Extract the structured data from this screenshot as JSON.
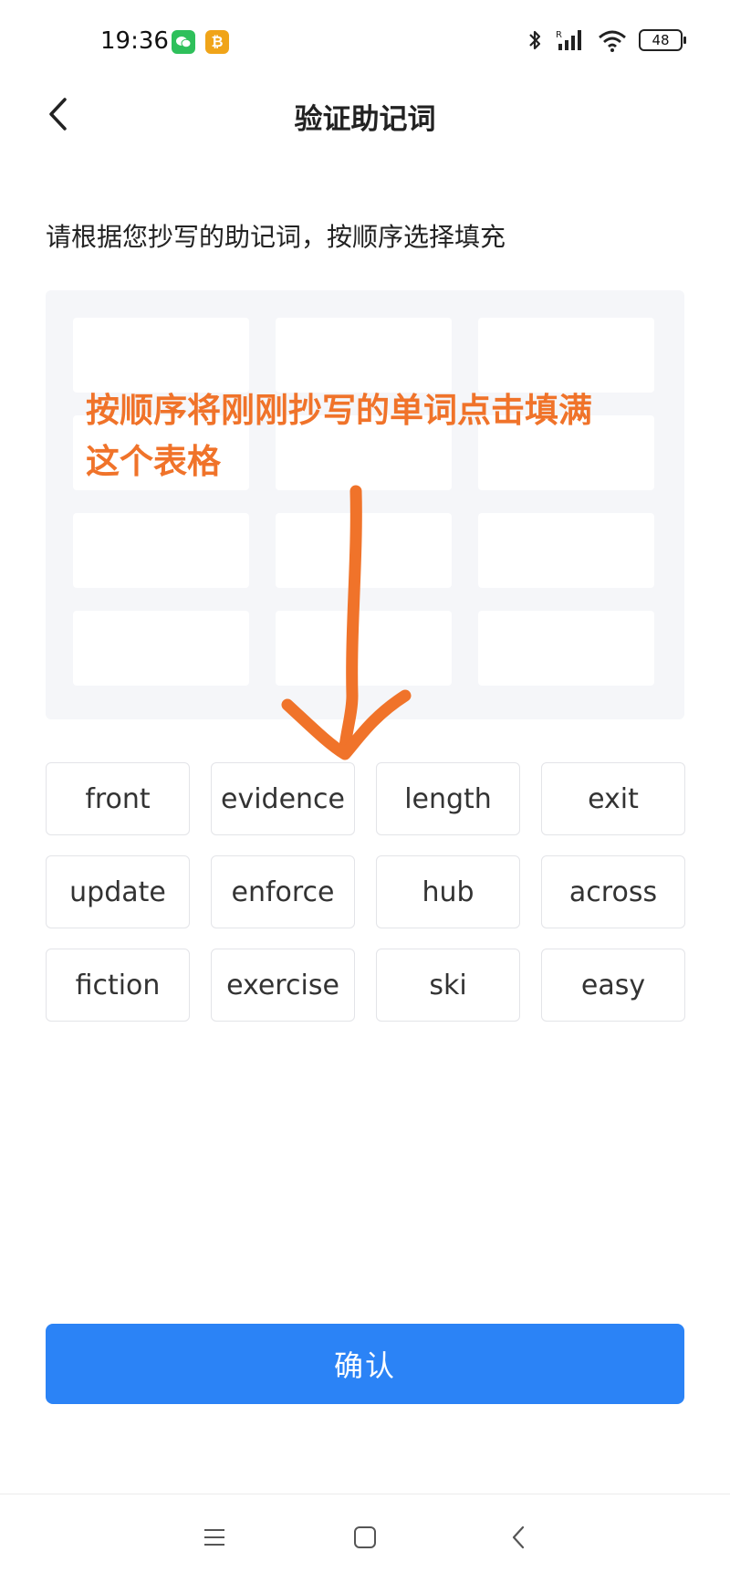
{
  "status_bar": {
    "time": "19:36",
    "battery": "48",
    "app_icons": [
      "wechat-icon",
      "bitcoin-icon"
    ],
    "system_icons": [
      "bluetooth-icon",
      "signal-icon",
      "wifi-icon",
      "battery-icon"
    ]
  },
  "header": {
    "title": "验证助记词",
    "back_icon": "chevron-left-icon"
  },
  "instruction": "请根据您抄写的助记词，按顺序选择填充",
  "annotation": {
    "text_line1": "按顺序将刚刚抄写的单词点击填满",
    "text_line2": "这个表格",
    "color": "#f0732a"
  },
  "slots_count": 12,
  "words": [
    "front",
    "evidence",
    "length",
    "exit",
    "update",
    "enforce",
    "hub",
    "across",
    "fiction",
    "exercise",
    "ski",
    "easy"
  ],
  "confirm_button": {
    "label": "确认",
    "color": "#2b83f6"
  },
  "system_nav": {
    "icons": [
      "menu-icon",
      "home-icon",
      "back-icon"
    ]
  }
}
